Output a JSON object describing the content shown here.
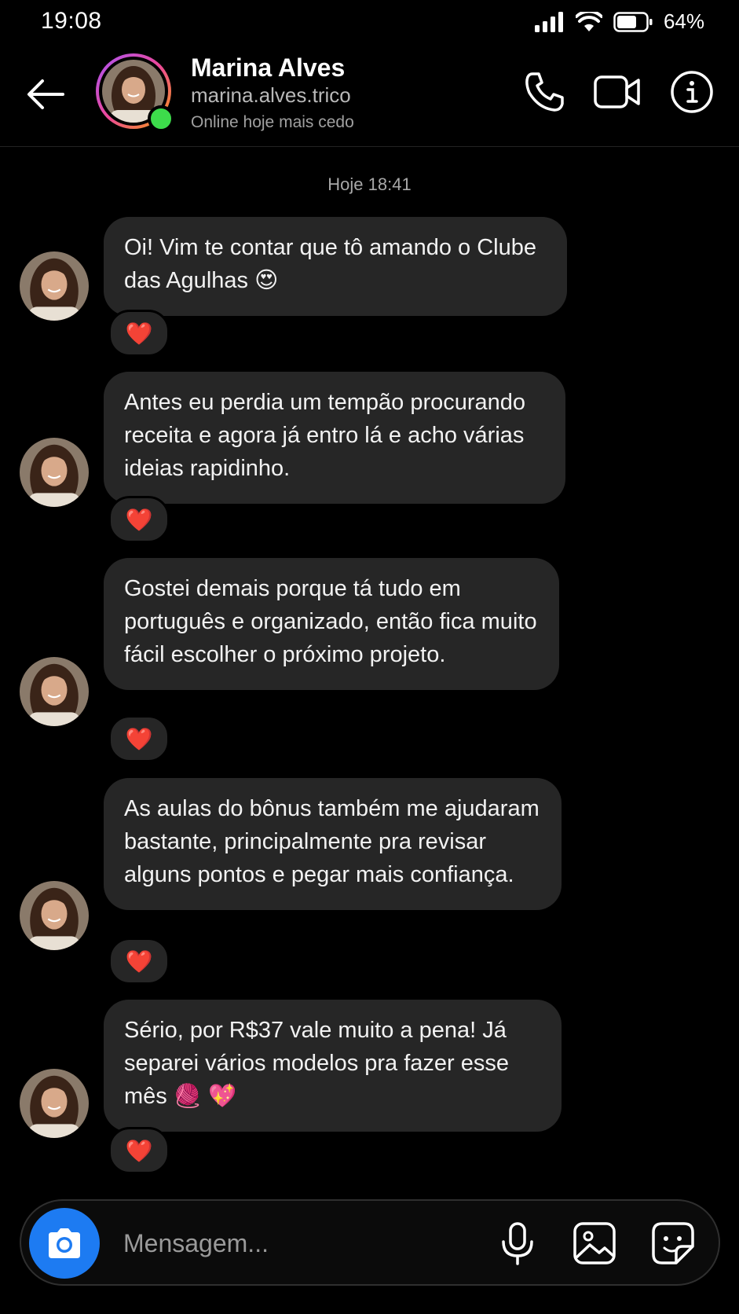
{
  "status_bar": {
    "time": "19:08",
    "battery_percent": "64%",
    "battery_level": 0.64
  },
  "header": {
    "name": "Marina Alves",
    "handle": "marina.alves.trico",
    "status": "Online hoje mais cedo",
    "online_color": "#3ddc4b"
  },
  "chat": {
    "date_separator": "Hoje 18:41",
    "messages": [
      {
        "text": "Oi! Vim te contar que tô amando o Clube das Agulhas 😍",
        "reaction": "❤️"
      },
      {
        "text": "Antes eu perdia um tempão procurando receita e agora já entro lá e acho várias ideias rapidinho.",
        "reaction": "❤️"
      },
      {
        "text": "Gostei demais porque tá tudo em português e organizado, então fica muito fácil escolher o próximo projeto.",
        "reaction": "❤️"
      },
      {
        "text": "As aulas do bônus também me ajudaram bastante, principalmente pra revisar alguns pontos e pegar mais confiança.",
        "reaction": "❤️"
      },
      {
        "text": "Sério, por R$37 vale muito a pena! Já separei vários modelos pra fazer esse mês 🧶 💖",
        "reaction": "❤️"
      }
    ]
  },
  "composer": {
    "placeholder": "Mensagem...",
    "accent_color": "#1d7bf2"
  },
  "icons": {
    "back": "arrow-left-icon",
    "call": "phone-icon",
    "video": "video-camera-icon",
    "info": "info-icon",
    "camera": "camera-icon",
    "mic": "microphone-icon",
    "gallery": "image-icon",
    "sticker": "sticker-icon"
  }
}
